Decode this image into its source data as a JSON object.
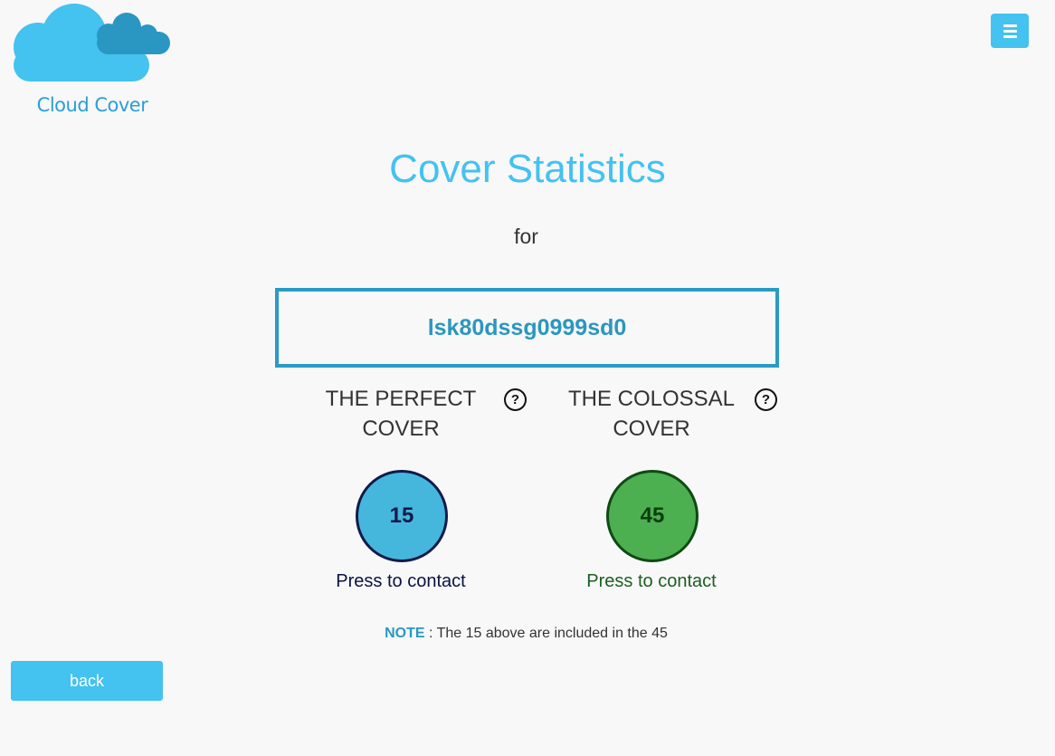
{
  "app": {
    "logo_text": "Cloud Cover",
    "logo_icon": "cloud-icon",
    "menu_icon": "hamburger-menu-icon"
  },
  "page": {
    "title": "Cover Statistics",
    "for_label": "for",
    "identifier": "lsk80dssg0999sd0"
  },
  "stats": [
    {
      "heading_line1": "THE PERFECT",
      "heading_line2": "COVER",
      "help_icon": "?",
      "count": "15",
      "action_label": "Press to contact",
      "color": "#45b7dc"
    },
    {
      "heading_line1": "THE COLOSSAL",
      "heading_line2": "COVER",
      "help_icon": "?",
      "count": "45",
      "action_label": "Press to contact",
      "color": "#4caf50"
    }
  ],
  "note": {
    "label": "NOTE",
    "text": " : The 15 above are included in the 45"
  },
  "footer": {
    "back_label": "back"
  },
  "colors": {
    "accent": "#44c2f0",
    "brand_dark": "#2a9bc4",
    "background": "#f8f8f9"
  }
}
